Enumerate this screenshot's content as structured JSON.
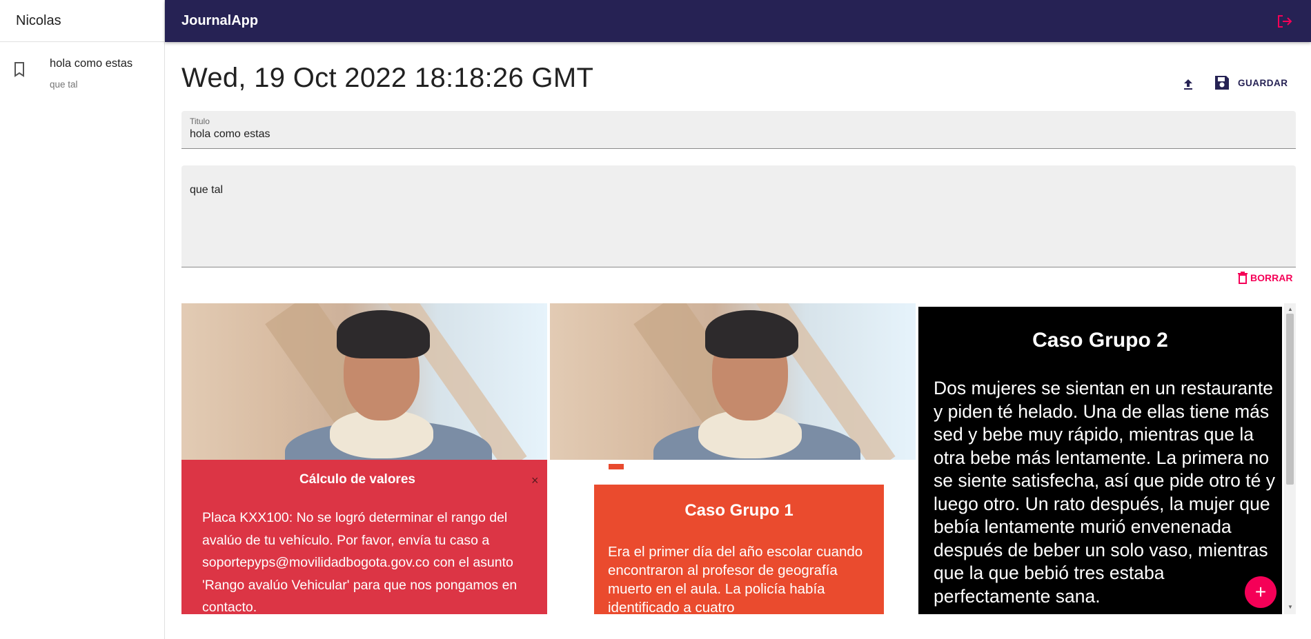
{
  "sidebar": {
    "user_name": "Nicolas",
    "entries": [
      {
        "title": "hola como estas",
        "body": "que tal"
      }
    ]
  },
  "appbar": {
    "title": "JournalApp"
  },
  "note": {
    "date": "Wed, 19 Oct 2022 18:18:26 GMT",
    "save_label": "GUARDAR",
    "title_label": "Titulo",
    "title_value": "hola como estas",
    "body_value": "que tal",
    "delete_label": "BORRAR"
  },
  "gallery": {
    "red_card": {
      "heading": "Cálculo de valores",
      "close": "×",
      "body": "Placa KXX100: No se logró determinar el rango del avalúo de tu vehículo. Por favor, envía tu caso a soportepyps@movilidadbogota.gov.co con el asunto 'Rango avalúo Vehicular' para que nos pongamos en contacto."
    },
    "orange_card": {
      "heading": "Caso Grupo 1",
      "body": "Era el primer día del año escolar cuando encontraron al profesor de geografía muerto en el aula. La policía había identificado a cuatro"
    },
    "black_card": {
      "heading": "Caso Grupo 2",
      "body": "Dos mujeres se sientan en un restaurante y piden té helado. Una de ellas tiene más sed y bebe muy rápido, mientras que la otra bebe más lentamente. La primera no se siente satisfecha, así que pide otro té y luego otro. Un rato después, la mujer que bebía lentamente murió envenenada después de beber un solo vaso, mientras que la que bebió tres estaba perfectamente sana."
    }
  },
  "fab_label": "+",
  "colors": {
    "appbar": "#262254",
    "accent": "#f50057",
    "red_card": "#dc3545",
    "orange_card": "#ea4b2e",
    "black_card": "#000000"
  },
  "icons": {
    "entry": "bookmark-icon",
    "logout": "logout-icon",
    "upload": "upload-icon",
    "save": "save-icon",
    "delete": "trash-icon",
    "fab": "plus-icon"
  }
}
